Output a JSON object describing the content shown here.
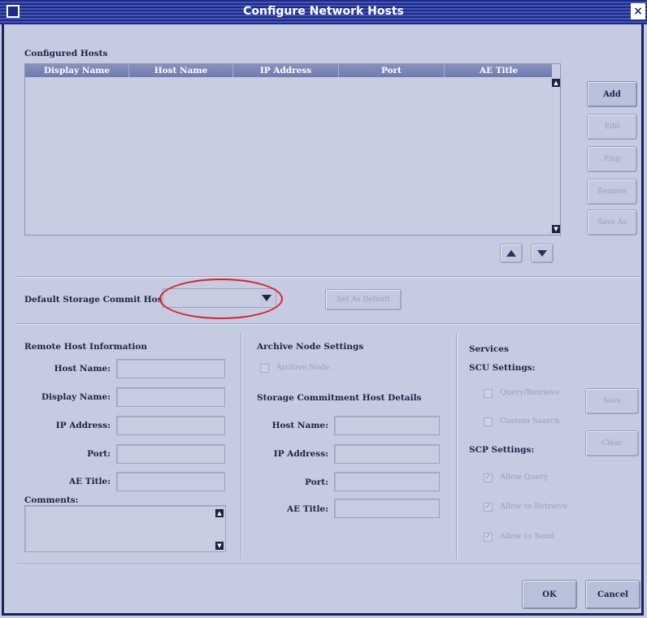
{
  "window": {
    "title": "Configure Network Hosts"
  },
  "configured_hosts": {
    "section_label": "Configured Hosts",
    "columns": [
      "Display Name",
      "Host Name",
      "IP Address",
      "Port",
      "AE Title"
    ],
    "rows": []
  },
  "side_buttons": {
    "add": "Add",
    "edit": "Edit",
    "ping": "Ping",
    "remove": "Remove",
    "save_as": "Save As"
  },
  "default_storage": {
    "label": "Default Storage Commit Host",
    "value": "",
    "set_as_default": "Set As Default"
  },
  "remote_host": {
    "section_label": "Remote Host Information",
    "host_name_label": "Host Name:",
    "display_name_label": "Display Name:",
    "ip_address_label": "IP Address:",
    "port_label": "Port:",
    "ae_title_label": "AE Title:",
    "comments_label": "Comments:"
  },
  "archive": {
    "section_label": "Archive Node Settings",
    "archive_node_label": "Archive Node",
    "archive_node_checked": false
  },
  "storage_commit": {
    "section_label": "Storage Commitment Host Details",
    "host_name_label": "Host Name:",
    "ip_address_label": "IP Address:",
    "port_label": "Port:",
    "ae_title_label": "AE Title:"
  },
  "services": {
    "section_label": "Services",
    "scu_label": "SCU Settings:",
    "query_retrieve": "Query/Retrieve",
    "custom_search": "Custom Search",
    "scp_label": "SCP Settings:",
    "allow_query": "Allow Query",
    "allow_retrieve": "Allow to Retrieve",
    "allow_send": "Allow to Send",
    "save": "Save",
    "clear": "Clear"
  },
  "footer": {
    "ok": "OK",
    "cancel": "Cancel"
  },
  "colors": {
    "title_bar": "#1d2a86",
    "background": "#c5cbe0",
    "highlight_ring": "#e02020"
  }
}
